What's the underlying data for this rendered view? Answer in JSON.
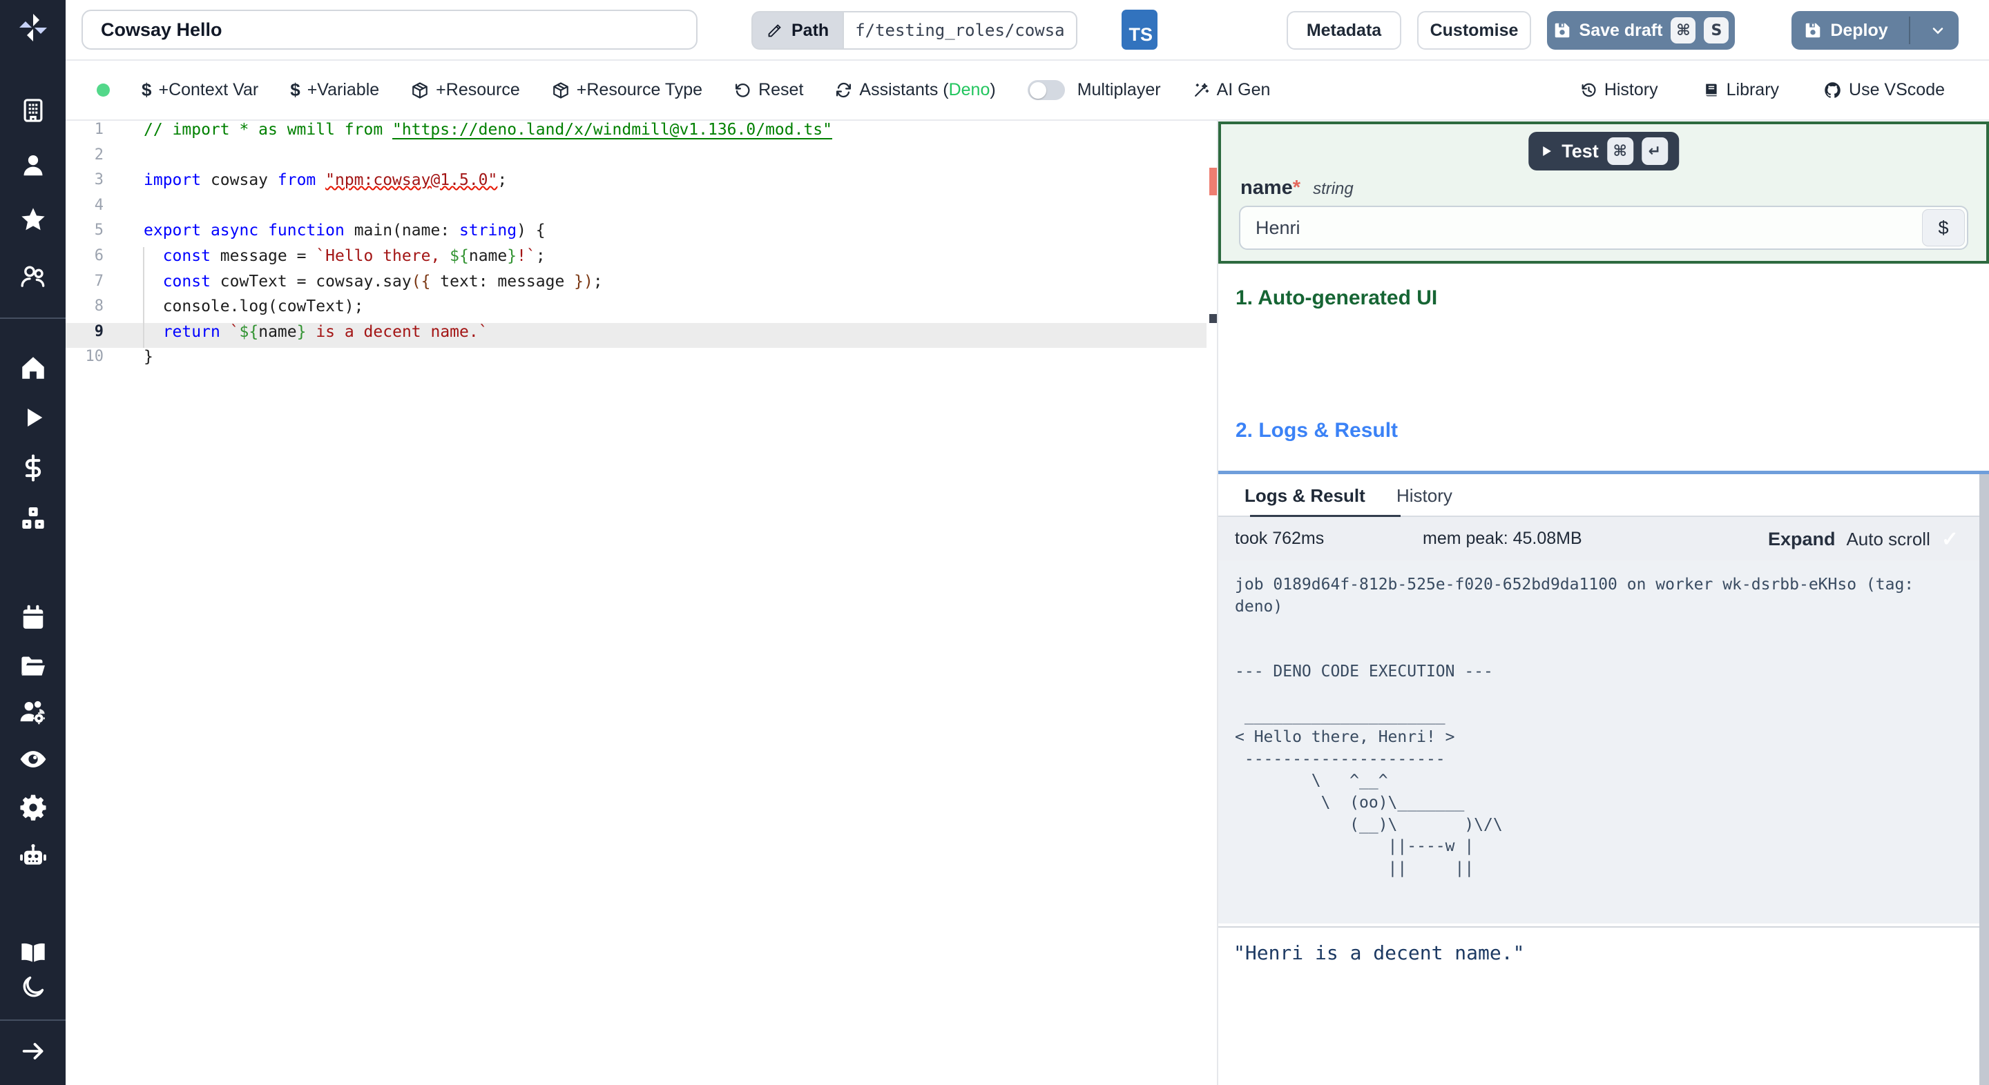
{
  "header": {
    "title_value": "Cowsay Hello",
    "path_label": "Path",
    "path_value": "f/testing_roles/cowsa",
    "lang_badge": "TS",
    "metadata_label": "Metadata",
    "customise_label": "Customise",
    "save_draft_label": "Save draft",
    "save_kbd_mod": "⌘",
    "save_kbd_key": "S",
    "deploy_label": "Deploy"
  },
  "toolbar": {
    "items": [
      {
        "label": "+Context Var",
        "icon": "dollar-icon"
      },
      {
        "label": "+Variable",
        "icon": "dollar-icon"
      },
      {
        "label": "+Resource",
        "icon": "package-icon"
      },
      {
        "label": "+Resource Type",
        "icon": "package-icon"
      },
      {
        "label": "Reset",
        "icon": "rotate-ccw-icon"
      },
      {
        "label_prefix": "Assistants (",
        "label_lang": "Deno",
        "label_suffix": ")",
        "icon": "refresh-icon"
      }
    ],
    "multiplayer_label": "Multiplayer",
    "ai_gen_label": "AI Gen",
    "history_label": "History",
    "library_label": "Library",
    "vscode_label": "Use VScode"
  },
  "editor": {
    "language": "typescript",
    "active_line": 9,
    "lines": [
      {
        "n": 1,
        "tokens": [
          [
            "cmt",
            "// import * as wmill from "
          ],
          [
            "cmtlink",
            "\"https://deno.land/x/windmill@v1.136.0/mod.ts\""
          ]
        ]
      },
      {
        "n": 2,
        "tokens": []
      },
      {
        "n": 3,
        "tokens": [
          [
            "kw",
            "import"
          ],
          [
            "pl",
            " cowsay "
          ],
          [
            "kw",
            "from"
          ],
          [
            "pl",
            " "
          ],
          [
            "strerr",
            "\"npm:cowsay@1.5.0\""
          ],
          [
            "pl",
            ";"
          ]
        ]
      },
      {
        "n": 4,
        "tokens": []
      },
      {
        "n": 5,
        "tokens": [
          [
            "kw",
            "export"
          ],
          [
            "pl",
            " "
          ],
          [
            "kw",
            "async"
          ],
          [
            "pl",
            " "
          ],
          [
            "kw",
            "function"
          ],
          [
            "pl",
            " main(name: "
          ],
          [
            "kw",
            "string"
          ],
          [
            "pl",
            ") {"
          ]
        ]
      },
      {
        "n": 6,
        "tokens": [
          [
            "pl",
            "  "
          ],
          [
            "kw",
            "const"
          ],
          [
            "pl",
            " message = "
          ],
          [
            "str",
            "`Hello there, "
          ],
          [
            "tpl",
            "${"
          ],
          [
            "pl",
            "name"
          ],
          [
            "tpl",
            "}"
          ],
          [
            "str",
            "!`"
          ],
          [
            "pl",
            ";"
          ]
        ]
      },
      {
        "n": 7,
        "tokens": [
          [
            "pl",
            "  "
          ],
          [
            "kw",
            "const"
          ],
          [
            "pl",
            " cowText = cowsay.say"
          ],
          [
            "brk",
            "({"
          ],
          [
            "pl",
            " text: message "
          ],
          [
            "brk",
            "})"
          ],
          [
            "pl",
            ";"
          ]
        ]
      },
      {
        "n": 8,
        "tokens": [
          [
            "pl",
            "  console.log(cowText);"
          ]
        ]
      },
      {
        "n": 9,
        "tokens": [
          [
            "pl",
            "  "
          ],
          [
            "kw",
            "return"
          ],
          [
            "pl",
            " "
          ],
          [
            "str",
            "`"
          ],
          [
            "tpl",
            "${"
          ],
          [
            "pl",
            "name"
          ],
          [
            "tpl",
            "}"
          ],
          [
            "str",
            " is a decent name.`"
          ]
        ]
      },
      {
        "n": 10,
        "tokens": [
          [
            "pl",
            "}"
          ]
        ]
      }
    ]
  },
  "right_panel": {
    "test_label": "Test",
    "test_kbd_mod": "⌘",
    "test_kbd_key": "↵",
    "arg_name": "name",
    "arg_required": "*",
    "arg_type": "string",
    "arg_value": "Henri",
    "var_picker_label": "$",
    "section1_title": "1. Auto-generated UI",
    "section2_title": "2. Logs & Result",
    "tabs": {
      "logs": "Logs & Result",
      "history": "History"
    },
    "stats": {
      "took": "took 762ms",
      "mem": "mem peak: 45.08MB",
      "expand": "Expand",
      "autoscroll": "Auto scroll",
      "autoscroll_check": "✓"
    },
    "log_text": "job 0189d64f-812b-525e-f020-652bd9da1100 on worker wk-dsrbb-eKHso (tag:\ndeno)\n\n\n--- DENO CODE EXECUTION ---\n\n _____________________\n< Hello there, Henri! >\n ---------------------\n        \\   ^__^\n         \\  (oo)\\_______\n            (__)\\       )\\/\\\n                ||----w |\n                ||     ||",
    "result_text": "\"Henri is a decent name.\""
  },
  "sidebar": {
    "icons": [
      "windmill-logo",
      "building",
      "user",
      "star",
      "users",
      "home",
      "play",
      "dollar",
      "boxes",
      "calendar",
      "folder-open",
      "users-cog",
      "eye",
      "gear",
      "bot",
      "book-open",
      "moon",
      "arrow-right"
    ]
  },
  "colors": {
    "sidebar_bg": "#1d2433",
    "primary_button": "#64809f",
    "test_button": "#333e4f",
    "ts_badge": "#3273be",
    "status_dot": "#53d88a",
    "deno_green": "#22c55e",
    "section1_green": "#166534",
    "section2_blue": "#3b82f6",
    "testbox_border": "#2d6a3f",
    "drag_bar_blue": "#6f9edb",
    "error_marker": "#ee7e71"
  }
}
